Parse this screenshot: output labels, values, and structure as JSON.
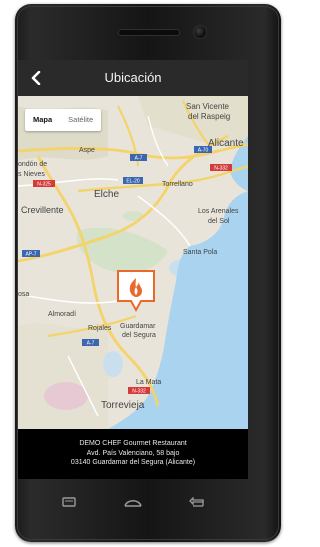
{
  "header": {
    "title": "Ubicación",
    "back_icon": "chevron-left-icon"
  },
  "map": {
    "type_control": {
      "map_label": "Mapa",
      "satellite_label": "Satélite",
      "selected": "Mapa"
    },
    "places": {
      "san_vicente_1": "San Vicente",
      "san_vicente_2": "del Raspeig",
      "aspe": "Aspe",
      "ondon_1": "ondón de",
      "ondon_2": "s Nieves",
      "elche": "Elche",
      "alicante": "Alicante",
      "torrellano": "Torrellano",
      "crevillente": "Crevillente",
      "arenales_1": "Los Arenales",
      "arenales_2": "del Sol",
      "santa_pola": "Santa Pola",
      "almoradi": "Almoradí",
      "rojales": "Rojales",
      "guardamar_1": "Guardamar",
      "guardamar_2": "del Segura",
      "osa": "osa",
      "la_mata": "La Mata",
      "torrevieja": "Torrevieja"
    },
    "road_badges": [
      "A-7",
      "A-70",
      "N-332",
      "N-325",
      "EL-20",
      "AP-7",
      "A-7",
      "N-332"
    ],
    "marker_icon": "flame-logo-icon"
  },
  "footer": {
    "line1": "DEMO CHEF Gourmet Restaurant",
    "line2": "Avd. País Valenciano, 58 bajo",
    "line3": "03140 Guardamar del Segura (Alicante)"
  },
  "nav_icons": [
    "recent-apps-icon",
    "home-icon",
    "back-icon"
  ],
  "colors": {
    "header": "#2a2a2a",
    "sea": "#a9d3ee",
    "land": "#e8e4da",
    "marker": "#e8692b"
  }
}
